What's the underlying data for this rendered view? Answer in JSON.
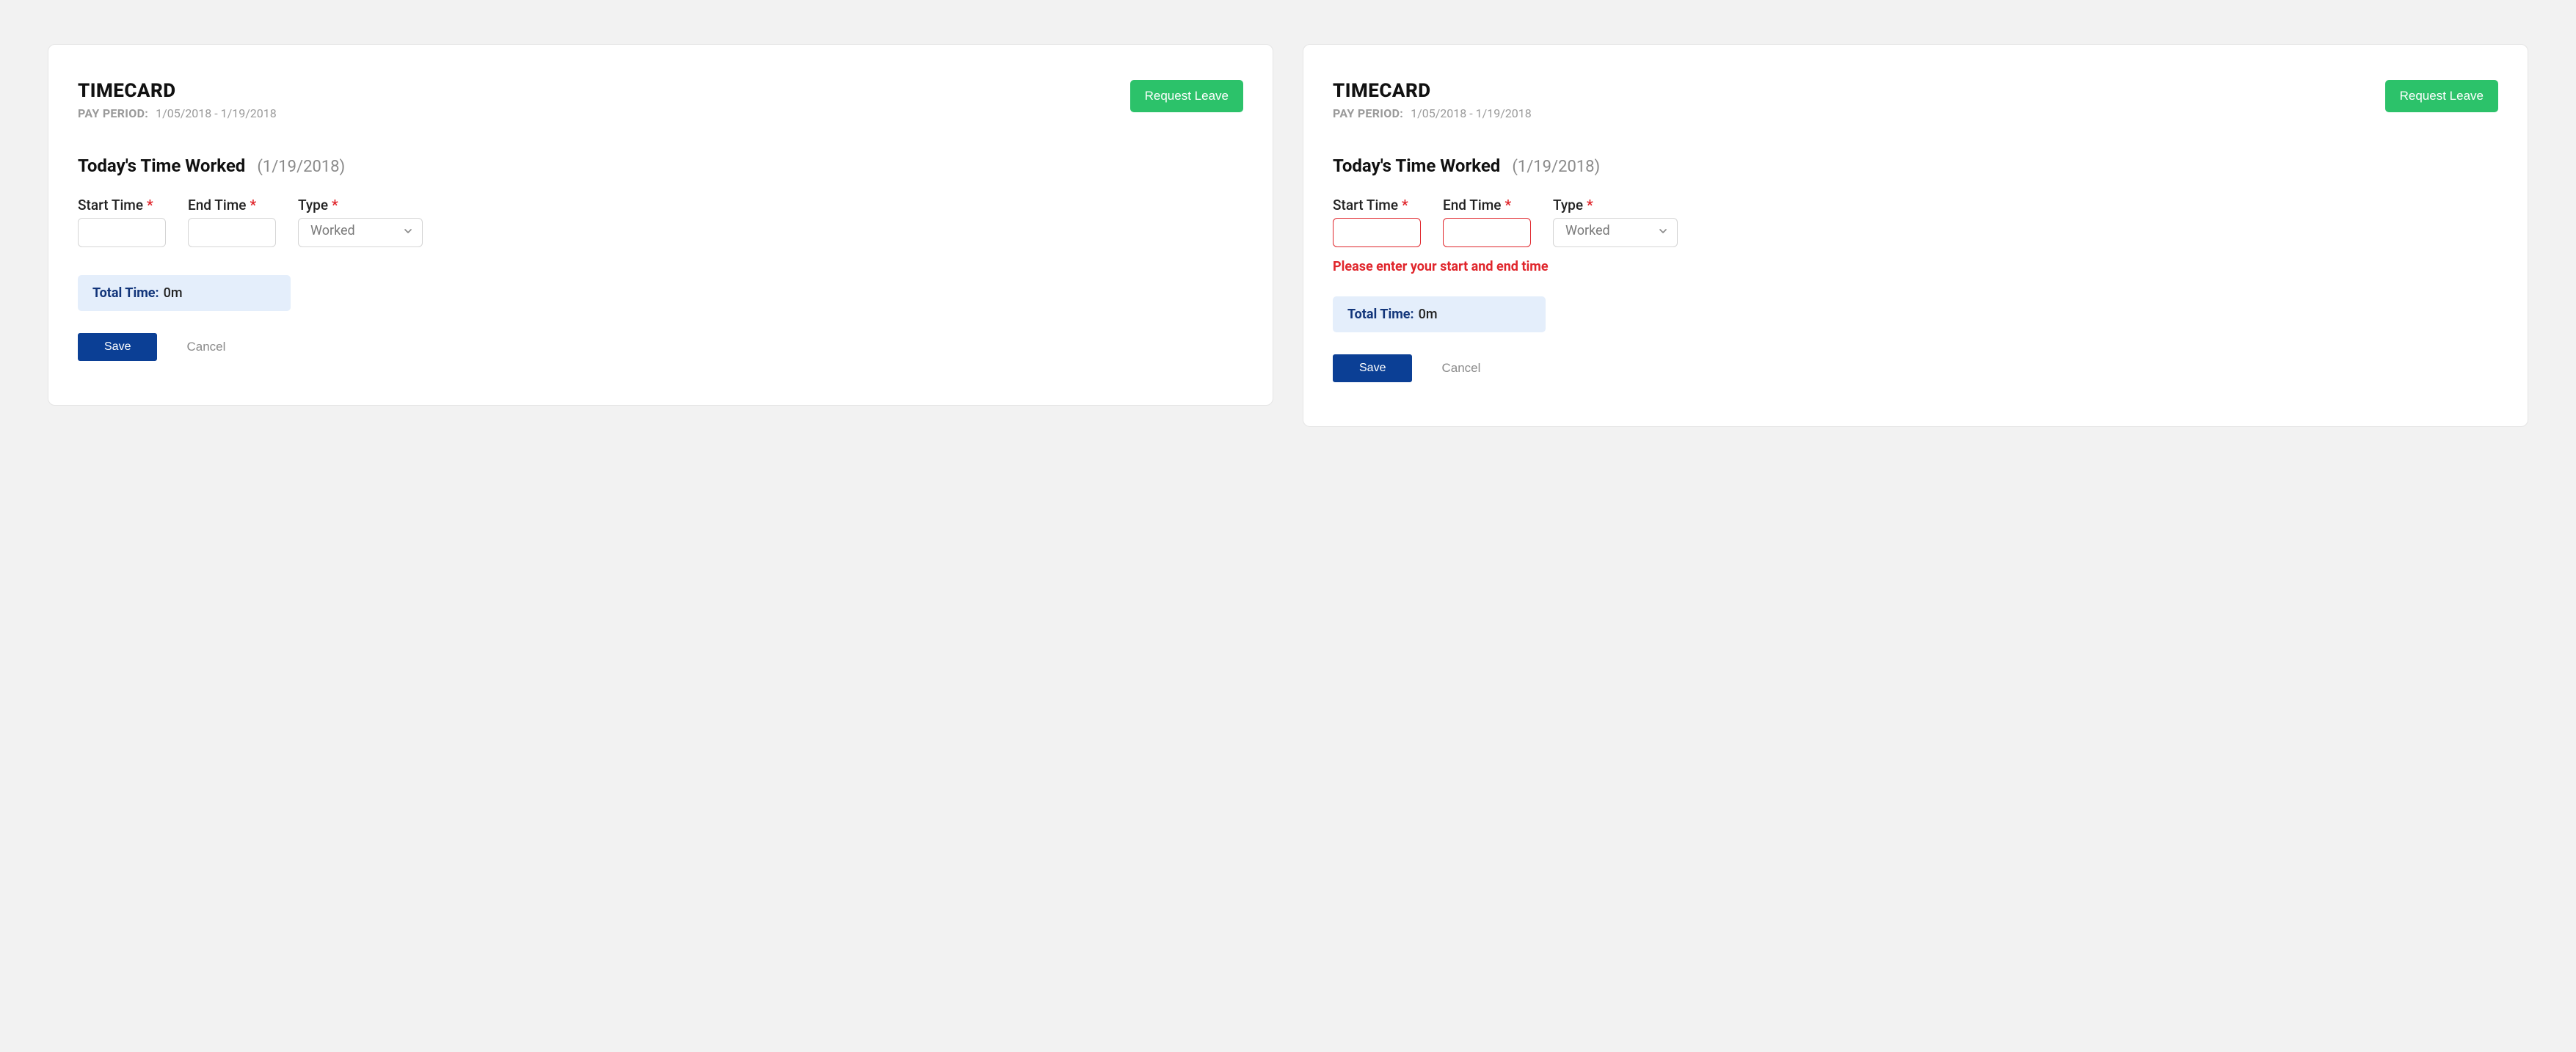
{
  "cards": [
    {
      "title": "TIMECARD",
      "pay_period_label": "PAY PERIOD:",
      "pay_period_value": "1/05/2018 - 1/19/2018",
      "request_leave_label": "Request Leave",
      "section_title": "Today's Time Worked",
      "section_date": "(1/19/2018)",
      "start_time_label": "Start Time",
      "end_time_label": "End Time",
      "type_label": "Type",
      "type_value": "Worked",
      "start_time_value": "",
      "end_time_value": "",
      "has_error": false,
      "error_message": "",
      "total_time_label": "Total Time:",
      "total_time_value": "0m",
      "save_label": "Save",
      "cancel_label": "Cancel"
    },
    {
      "title": "TIMECARD",
      "pay_period_label": "PAY PERIOD:",
      "pay_period_value": "1/05/2018 - 1/19/2018",
      "request_leave_label": "Request Leave",
      "section_title": "Today's Time Worked",
      "section_date": "(1/19/2018)",
      "start_time_label": "Start Time",
      "end_time_label": "End Time",
      "type_label": "Type",
      "type_value": "Worked",
      "start_time_value": "",
      "end_time_value": "",
      "has_error": true,
      "error_message": "Please enter your start and end time",
      "total_time_label": "Total Time:",
      "total_time_value": "0m",
      "save_label": "Save",
      "cancel_label": "Cancel"
    }
  ],
  "required_mark": "*"
}
